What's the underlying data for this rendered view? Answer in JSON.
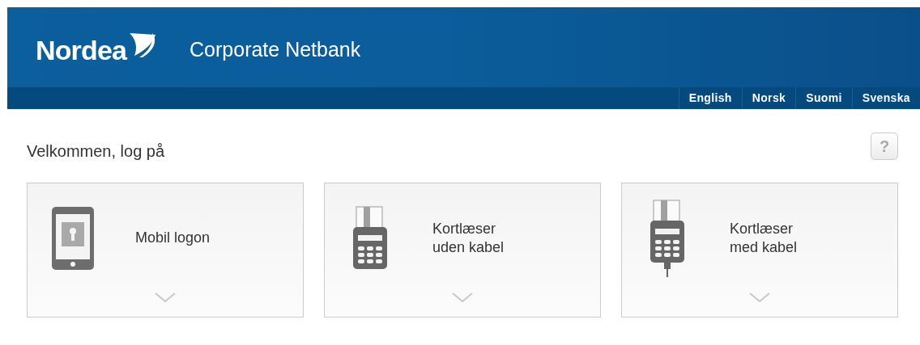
{
  "header": {
    "logo": "Nordea",
    "title": "Corporate Netbank"
  },
  "languages": [
    {
      "label": "English"
    },
    {
      "label": "Norsk"
    },
    {
      "label": "Suomi"
    },
    {
      "label": "Svenska"
    }
  ],
  "heading": "Velkommen, log på",
  "help": "?",
  "login_options": [
    {
      "kind": "mobile",
      "lines": [
        "Mobil logon"
      ]
    },
    {
      "kind": "reader_wireless",
      "lines": [
        "Kortlæser",
        "uden kabel"
      ]
    },
    {
      "kind": "reader_cable",
      "lines": [
        "Kortlæser",
        "med kabel"
      ]
    }
  ]
}
